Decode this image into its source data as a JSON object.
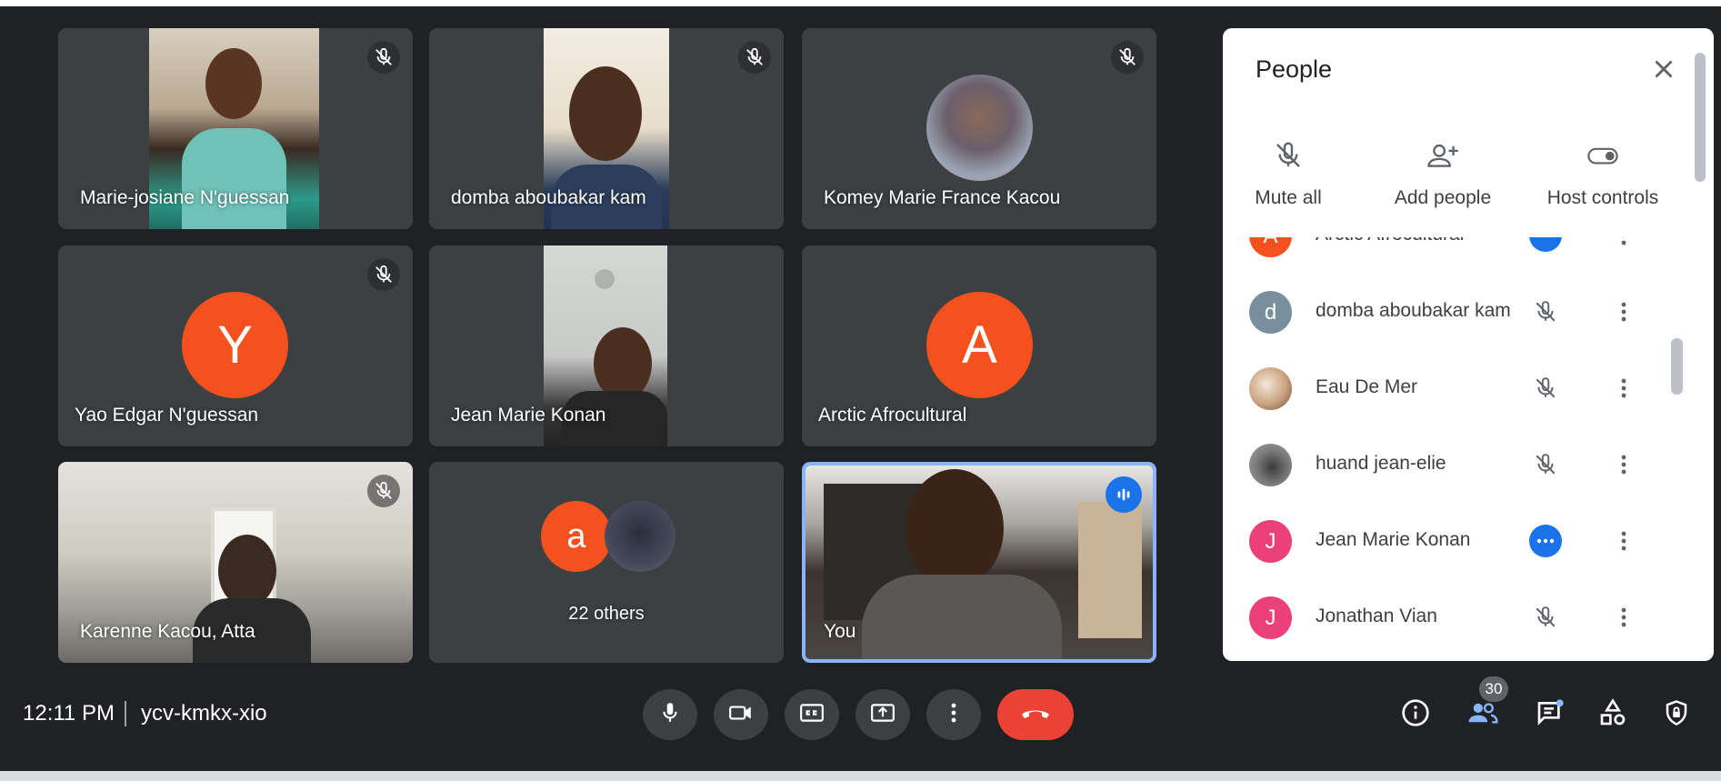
{
  "tiles": [
    {
      "name": "Marie-josiane N'guessan"
    },
    {
      "name": "domba aboubakar kam"
    },
    {
      "name": "Komey Marie France Kacou"
    },
    {
      "name": "Yao Edgar N'guessan",
      "initial": "Y"
    },
    {
      "name": "Jean Marie Konan"
    },
    {
      "name": "Arctic Afrocultural",
      "initial": "A"
    },
    {
      "name": "Karenne Kacou, Atta"
    },
    {
      "name": "22 others",
      "initial": "a"
    },
    {
      "name": "You"
    }
  ],
  "panel": {
    "title": "People",
    "actions": {
      "mute_all": "Mute all",
      "add_people": "Add people",
      "host_controls": "Host controls"
    },
    "participants": [
      {
        "initial": "A",
        "name": "Arctic Afrocultural",
        "color": "#f4511e",
        "status": "more"
      },
      {
        "initial": "d",
        "name": "domba aboubakar kam",
        "color": "#78909c",
        "status": "muted"
      },
      {
        "initial": "",
        "name": "Eau De Mer",
        "color": "#c9a27e",
        "status": "muted"
      },
      {
        "initial": "",
        "name": "huand jean-elie",
        "color": "#7a7a7a",
        "status": "muted"
      },
      {
        "initial": "J",
        "name": "Jean Marie Konan",
        "color": "#ec407a",
        "status": "more"
      },
      {
        "initial": "J",
        "name": "Jonathan Vian",
        "color": "#ec407a",
        "status": "muted"
      }
    ]
  },
  "bottom": {
    "time": "12:11 PM",
    "meeting_code": "ycv-kmkx-xio",
    "people_count": "30"
  },
  "colors": {
    "accent": "#1a73e8",
    "hangup": "#ea4335",
    "avatar_orange": "#f4511e"
  }
}
